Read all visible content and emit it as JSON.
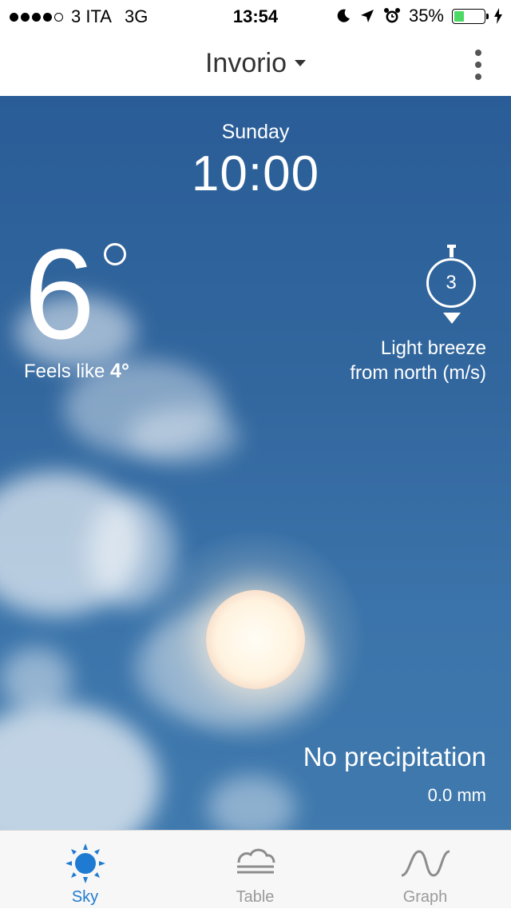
{
  "status_bar": {
    "carrier": "3 ITA",
    "network": "3G",
    "time": "13:54",
    "battery": "35%",
    "battery_level": 0.35,
    "signal_bars": 4,
    "icons": [
      "moon-icon",
      "location-arrow-icon",
      "alarm-icon",
      "charging-bolt-icon"
    ]
  },
  "nav": {
    "title": "Invorio",
    "menu_icon": "more-vertical-icon"
  },
  "forecast": {
    "day": "Sunday",
    "time": "10:00",
    "temperature": "6",
    "feels_like_label": "Feels like",
    "feels_like_value": "4°",
    "wind_speed": "3",
    "wind_desc_line1": "Light breeze",
    "wind_desc_line2": "from north (m/s)",
    "precipitation": "No precipitation",
    "precipitation_amount": "0.0 mm"
  },
  "tabs": [
    {
      "label": "Sky",
      "icon": "sun-icon",
      "active": true
    },
    {
      "label": "Table",
      "icon": "table-cloud-icon",
      "active": false
    },
    {
      "label": "Graph",
      "icon": "graph-wave-icon",
      "active": false
    }
  ],
  "colors": {
    "accent": "#1f7bd1",
    "sky_top": "#2a5d97",
    "sky_bottom": "#3f79ad",
    "battery_fill": "#4cd964"
  }
}
